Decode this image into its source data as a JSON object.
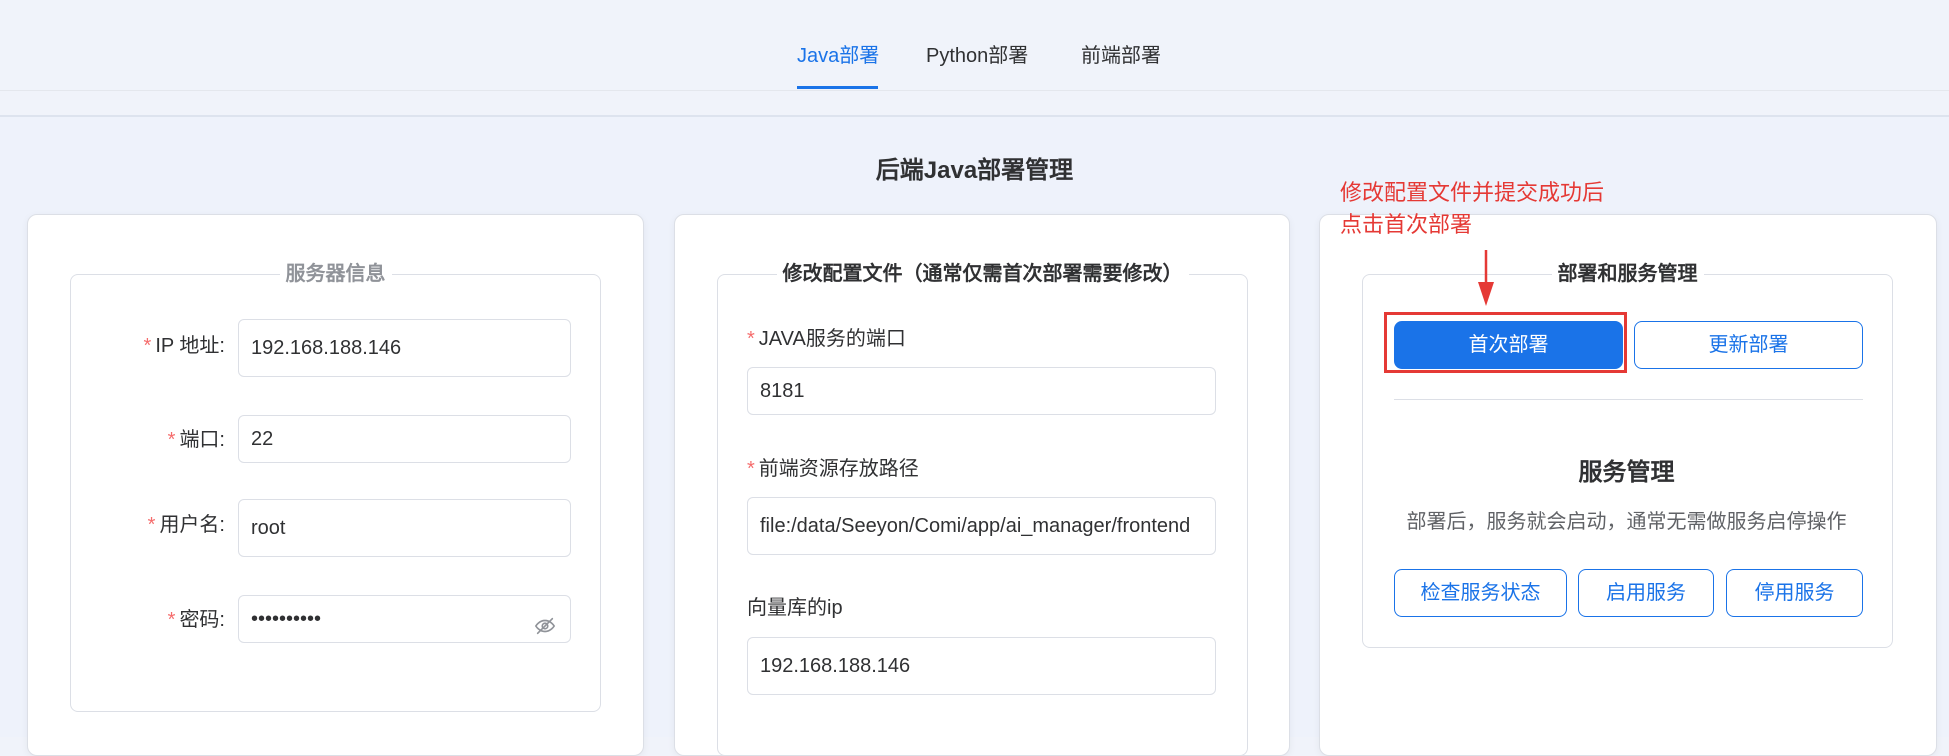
{
  "tabs": [
    {
      "label": "Java部署"
    },
    {
      "label": "Python部署"
    },
    {
      "label": "前端部署"
    }
  ],
  "page_title": "后端Java部署管理",
  "server_info": {
    "legend": "服务器信息",
    "ip_label": "IP 地址:",
    "ip_value": "192.168.188.146",
    "port_label": "端口:",
    "port_value": "22",
    "user_label": "用户名:",
    "user_value": "root",
    "password_label": "密码:",
    "password_value": "••••••••••",
    "required_mark": "*"
  },
  "config": {
    "legend": "修改配置文件（通常仅需首次部署需要修改）",
    "java_port_label": "JAVA服务的端口",
    "java_port_value": "8181",
    "frontend_path_label": "前端资源存放路径",
    "frontend_path_value": "file:/data/Seeyon/Comi/app/ai_manager/frontend",
    "vector_ip_label": "向量库的ip",
    "vector_ip_value": "192.168.188.146",
    "required_mark": "*"
  },
  "deploy": {
    "legend": "部署和服务管理",
    "first_deploy_label": "首次部署",
    "update_deploy_label": "更新部署",
    "service_title": "服务管理",
    "service_hint": "部署后，服务就会启动，通常无需做服务启停操作",
    "check_label": "检查服务状态",
    "start_label": "启用服务",
    "stop_label": "停用服务"
  },
  "annotation": {
    "line1": "修改配置文件并提交成功后",
    "line2": "点击首次部署"
  },
  "colors": {
    "accent": "#1a73e8",
    "required": "#f56c6c",
    "annotation": "#e53935"
  }
}
